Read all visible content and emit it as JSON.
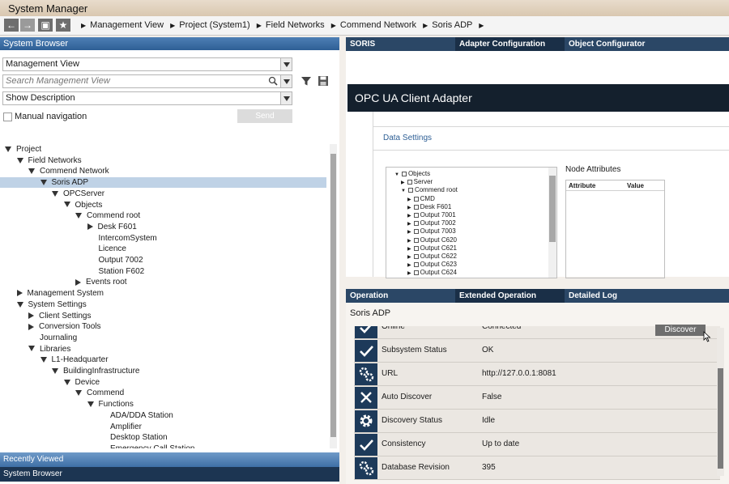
{
  "window": {
    "title": "System Manager"
  },
  "navigation": {
    "breadcrumb": [
      "Management View",
      "Project (System1)",
      "Field Networks",
      "Commend Network",
      "Soris ADP"
    ]
  },
  "system_browser": {
    "header": "System Browser",
    "view_select": "Management View",
    "search_placeholder": "Search Management View",
    "description_select": "Show Description",
    "manual_navigation_label": "Manual navigation",
    "send_label": "Send",
    "tree": [
      {
        "label": "Project",
        "level": 0,
        "state": "open"
      },
      {
        "label": "Field Networks",
        "level": 1,
        "state": "open"
      },
      {
        "label": "Commend Network",
        "level": 2,
        "state": "open"
      },
      {
        "label": "Soris ADP",
        "level": 3,
        "state": "open",
        "selected": true
      },
      {
        "label": "OPCServer",
        "level": 4,
        "state": "open"
      },
      {
        "label": "Objects",
        "level": 5,
        "state": "open"
      },
      {
        "label": "Commend root",
        "level": 6,
        "state": "open"
      },
      {
        "label": "Desk F601",
        "level": 7,
        "state": "closed"
      },
      {
        "label": "IntercomSystem",
        "level": 7,
        "state": "leaf"
      },
      {
        "label": "Licence",
        "level": 7,
        "state": "leaf"
      },
      {
        "label": "Output 7002",
        "level": 7,
        "state": "leaf"
      },
      {
        "label": "Station F602",
        "level": 7,
        "state": "leaf"
      },
      {
        "label": "Events root",
        "level": 6,
        "state": "closed"
      },
      {
        "label": "Management System",
        "level": 1,
        "state": "closed"
      },
      {
        "label": "System Settings",
        "level": 1,
        "state": "open"
      },
      {
        "label": "Client Settings",
        "level": 2,
        "state": "closed"
      },
      {
        "label": "Conversion Tools",
        "level": 2,
        "state": "closed"
      },
      {
        "label": "Journaling",
        "level": 2,
        "state": "leaf"
      },
      {
        "label": "Libraries",
        "level": 2,
        "state": "open"
      },
      {
        "label": "L1-Headquarter",
        "level": 3,
        "state": "open"
      },
      {
        "label": "BuildingInfrastructure",
        "level": 4,
        "state": "open"
      },
      {
        "label": "Device",
        "level": 5,
        "state": "open"
      },
      {
        "label": "Commend",
        "level": 6,
        "state": "open"
      },
      {
        "label": "Functions",
        "level": 7,
        "state": "open"
      },
      {
        "label": "ADA/DDA Station",
        "level": 8,
        "state": "leaf"
      },
      {
        "label": "Amplifier",
        "level": 8,
        "state": "leaf"
      },
      {
        "label": "Desktop Station",
        "level": 8,
        "state": "leaf"
      },
      {
        "label": "Emergency Call Station",
        "level": 8,
        "state": "leaf"
      }
    ],
    "recently_viewed": "Recently Viewed",
    "bottom_tab": "System Browser"
  },
  "top_pane": {
    "tabs": [
      "SORIS",
      "Adapter Configuration",
      "Object Configurator"
    ],
    "active_tab": "Adapter Configuration",
    "adapter_title": "OPC UA Client Adapter",
    "section_title": "Data Settings",
    "node_tree": [
      {
        "label": "Objects",
        "level": 0,
        "state": "open"
      },
      {
        "label": "Server",
        "level": 1,
        "state": "closed"
      },
      {
        "label": "Commend root",
        "level": 1,
        "state": "open"
      },
      {
        "label": "CMD",
        "level": 2,
        "state": "closed"
      },
      {
        "label": "Desk F601",
        "level": 2,
        "state": "closed"
      },
      {
        "label": "Output 7001",
        "level": 2,
        "state": "closed"
      },
      {
        "label": "Output 7002",
        "level": 2,
        "state": "closed"
      },
      {
        "label": "Output 7003",
        "level": 2,
        "state": "closed"
      },
      {
        "label": "Output C620",
        "level": 2,
        "state": "closed"
      },
      {
        "label": "Output C621",
        "level": 2,
        "state": "closed"
      },
      {
        "label": "Output C622",
        "level": 2,
        "state": "closed"
      },
      {
        "label": "Output C623",
        "level": 2,
        "state": "closed"
      },
      {
        "label": "Output C624",
        "level": 2,
        "state": "closed"
      }
    ],
    "node_attributes_title": "Node Attributes",
    "attribute_columns": [
      "Attribute",
      "Value"
    ]
  },
  "bottom_pane": {
    "tabs": [
      "Operation",
      "Extended Operation",
      "Detailed Log"
    ],
    "active_tab": "Extended Operation",
    "subtitle": "Soris ADP",
    "properties": [
      {
        "name": "Online",
        "value": "Connected",
        "icon": "check-icon"
      },
      {
        "name": "Subsystem Status",
        "value": "OK",
        "icon": "check-icon"
      },
      {
        "name": "URL",
        "value": "http://127.0.0.1:8081",
        "icon": "gears-icon"
      },
      {
        "name": "Auto Discover",
        "value": "False",
        "icon": "cross-icon"
      },
      {
        "name": "Discovery Status",
        "value": "Idle",
        "icon": "gear-icon"
      },
      {
        "name": "Consistency",
        "value": "Up to date",
        "icon": "check-icon"
      },
      {
        "name": "Database Revision",
        "value": "395",
        "icon": "gears-icon"
      }
    ],
    "discover_label": "Discover"
  }
}
